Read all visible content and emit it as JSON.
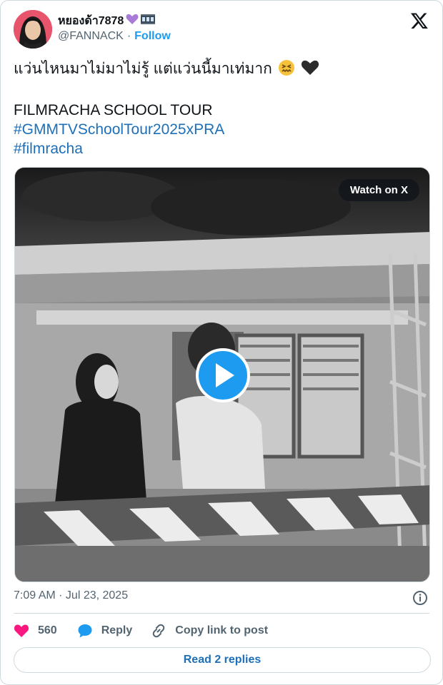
{
  "author": {
    "display_name": "หยองด้า7878",
    "name_badges": [
      "purple-heart-emoji",
      "film-frames-emoji"
    ],
    "handle": "@FANNACK",
    "separator": "·",
    "follow_label": "Follow"
  },
  "tweet": {
    "line1": "แว่นไหนมาไม่มาไม่รู้ แต่แว่นนี้มาเท่มาก",
    "line1_emojis": [
      "confounded-face-emoji",
      "black-heart-emoji"
    ],
    "line2": "FILMRACHA SCHOOL TOUR",
    "hashtag1": "#GMMTVSchoolTour2025xPRA",
    "hashtag2": "#filmracha"
  },
  "media": {
    "watch_label": "Watch on X",
    "play_icon": "play-icon"
  },
  "meta": {
    "timestamp": "7:09 AM · Jul 23, 2025"
  },
  "actions": {
    "like_count": "560",
    "reply_label": "Reply",
    "copy_label": "Copy link to post"
  },
  "footer": {
    "replies_label": "Read 2 replies"
  },
  "colors": {
    "accent": "#1d9bf0",
    "link": "#1d6fb8",
    "like": "#f91880",
    "muted": "#536471",
    "border": "#cfd9de"
  }
}
